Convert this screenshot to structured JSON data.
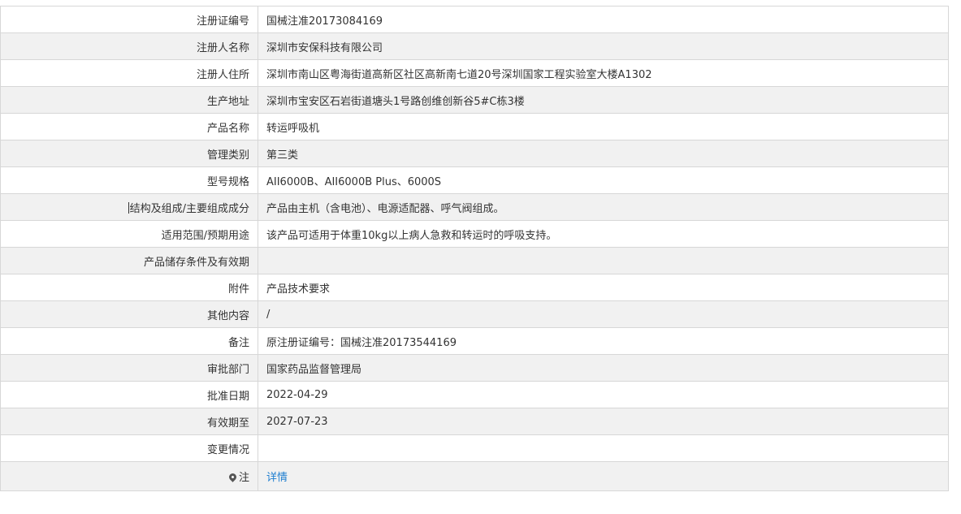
{
  "rows": [
    {
      "label": "注册证编号",
      "value": "国械注准20173084169"
    },
    {
      "label": "注册人名称",
      "value": "深圳市安保科技有限公司"
    },
    {
      "label": "注册人住所",
      "value": "深圳市南山区粤海街道高新区社区高新南七道20号深圳国家工程实验室大楼A1302"
    },
    {
      "label": "生产地址",
      "value": "深圳市宝安区石岩街道塘头1号路创维创新谷5#C栋3楼"
    },
    {
      "label": "产品名称",
      "value": "转运呼吸机"
    },
    {
      "label": "管理类别",
      "value": "第三类"
    },
    {
      "label": "型号规格",
      "value": "AII6000B、AII6000B Plus、6000S"
    },
    {
      "label": "结构及组成/主要组成成分",
      "value": "产品由主机（含电池）、电源适配器、呼气阀组成。"
    },
    {
      "label": "适用范围/预期用途",
      "value": "该产品可适用于体重10kg以上病人急救和转运时的呼吸支持。"
    },
    {
      "label": "产品储存条件及有效期",
      "value": ""
    },
    {
      "label": "附件",
      "value": "产品技术要求"
    },
    {
      "label": "其他内容",
      "value": "/"
    },
    {
      "label": "备注",
      "value": "原注册证编号：国械注准20173544169"
    },
    {
      "label": "审批部门",
      "value": "国家药品监督管理局"
    },
    {
      "label": "批准日期",
      "value": "2022-04-29"
    },
    {
      "label": "有效期至",
      "value": "2027-07-23"
    },
    {
      "label": "变更情况",
      "value": ""
    }
  ],
  "note_row": {
    "label": "注",
    "icon": "pin-icon",
    "link_text": "详情"
  },
  "colors": {
    "alt_row_bg": "#f1f1f1",
    "border": "#d7d7d7",
    "link": "#1e7ed0",
    "text": "#333333"
  }
}
